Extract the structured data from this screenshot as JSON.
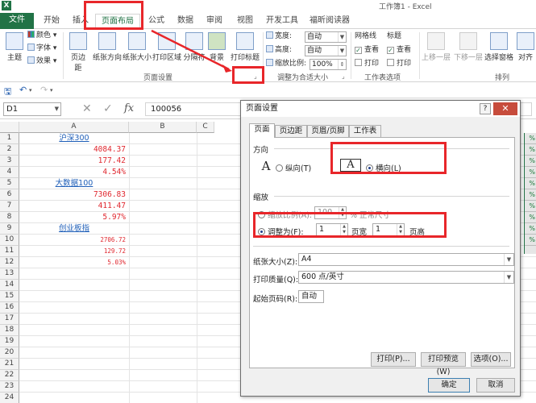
{
  "window": {
    "title": "工作簿1 - Excel",
    "app_icon": "X"
  },
  "tabs": [
    {
      "label": "文件"
    },
    {
      "label": "开始"
    },
    {
      "label": "插入"
    },
    {
      "label": "页面布局"
    },
    {
      "label": "公式"
    },
    {
      "label": "数据"
    },
    {
      "label": "审阅"
    },
    {
      "label": "视图"
    },
    {
      "label": "开发工具"
    },
    {
      "label": "福昕阅读器"
    }
  ],
  "ribbon": {
    "theme": {
      "main": "主题",
      "colors": "颜色",
      "fonts": "字体",
      "effects": "效果"
    },
    "page_setup": {
      "margins": "页边距",
      "orientation": "纸张方向",
      "size": "纸张大小",
      "print_area": "打印区域",
      "breaks": "分隔符",
      "background": "背景",
      "print_titles": "打印标题",
      "group_label": "页面设置"
    },
    "scale": {
      "width_label": "宽度:",
      "width_value": "自动",
      "height_label": "高度:",
      "height_value": "自动",
      "scale_label": "缩放比例:",
      "scale_value": "100%",
      "group_label": "调整为合适大小"
    },
    "sheet_options": {
      "gridlines": "网格线",
      "headings": "标题",
      "view": "查看",
      "print": "打印",
      "group_label": "工作表选项"
    },
    "arrange": {
      "bring_forward": "上移一层",
      "send_backward": "下移一层",
      "selection_pane": "选择窗格",
      "align": "对齐",
      "group_label": "排列"
    }
  },
  "formula_bar": {
    "name_box": "D1",
    "formula": "100056"
  },
  "columns": [
    "A",
    "B",
    "C"
  ],
  "rows": [
    "1",
    "2",
    "3",
    "4",
    "5",
    "6",
    "7",
    "8",
    "9",
    "10",
    "11",
    "12",
    "13",
    "14",
    "15",
    "16",
    "17",
    "18",
    "19",
    "20",
    "21",
    "22",
    "23",
    "24"
  ],
  "cells": [
    {
      "text": "沪深300",
      "style": "center"
    },
    {
      "text": "4084.37",
      "style": "right"
    },
    {
      "text": "177.42",
      "style": "right"
    },
    {
      "text": "4.54%",
      "style": "right"
    },
    {
      "text": "大数据100",
      "style": "center"
    },
    {
      "text": "7306.83",
      "style": "right"
    },
    {
      "text": "411.47",
      "style": "right"
    },
    {
      "text": "5.97%",
      "style": "right"
    },
    {
      "text": "创业板指",
      "style": "center"
    },
    {
      "text": "2706.72",
      "style": "right small"
    },
    {
      "text": "129.72",
      "style": "right small"
    },
    {
      "text": "5.03%",
      "style": "right small"
    }
  ],
  "right_strip": [
    "%",
    "%",
    "%",
    "%",
    "%",
    "%",
    "%",
    "%",
    "%",
    "%"
  ],
  "dialog": {
    "title": "页面设置",
    "help": "?",
    "close": "✕",
    "tabs": [
      "页面",
      "页边距",
      "页眉/页脚",
      "工作表"
    ],
    "orientation_label": "方向",
    "portrait": "纵向(T)",
    "landscape": "横向(L)",
    "scaling_label": "缩放",
    "adjust_to": "缩放比例(A):",
    "adjust_value": "100",
    "adjust_suffix": "% 正常尺寸",
    "fit_to": "调整为(F):",
    "fit_pages_wide": "1",
    "pages_wide_label": "页宽",
    "fit_pages_tall": "1",
    "pages_tall_label": "页高",
    "paper_size_label": "纸张大小(Z):",
    "paper_size": "A4",
    "print_quality_label": "打印质量(Q):",
    "print_quality": "600 点/英寸",
    "first_page_label": "起始页码(R):",
    "first_page": "自动",
    "btn_print": "打印(P)...",
    "btn_preview": "打印预览(W)",
    "btn_options": "选项(O)...",
    "btn_ok": "确定",
    "btn_cancel": "取消"
  },
  "annotation_color": "#e8262a"
}
